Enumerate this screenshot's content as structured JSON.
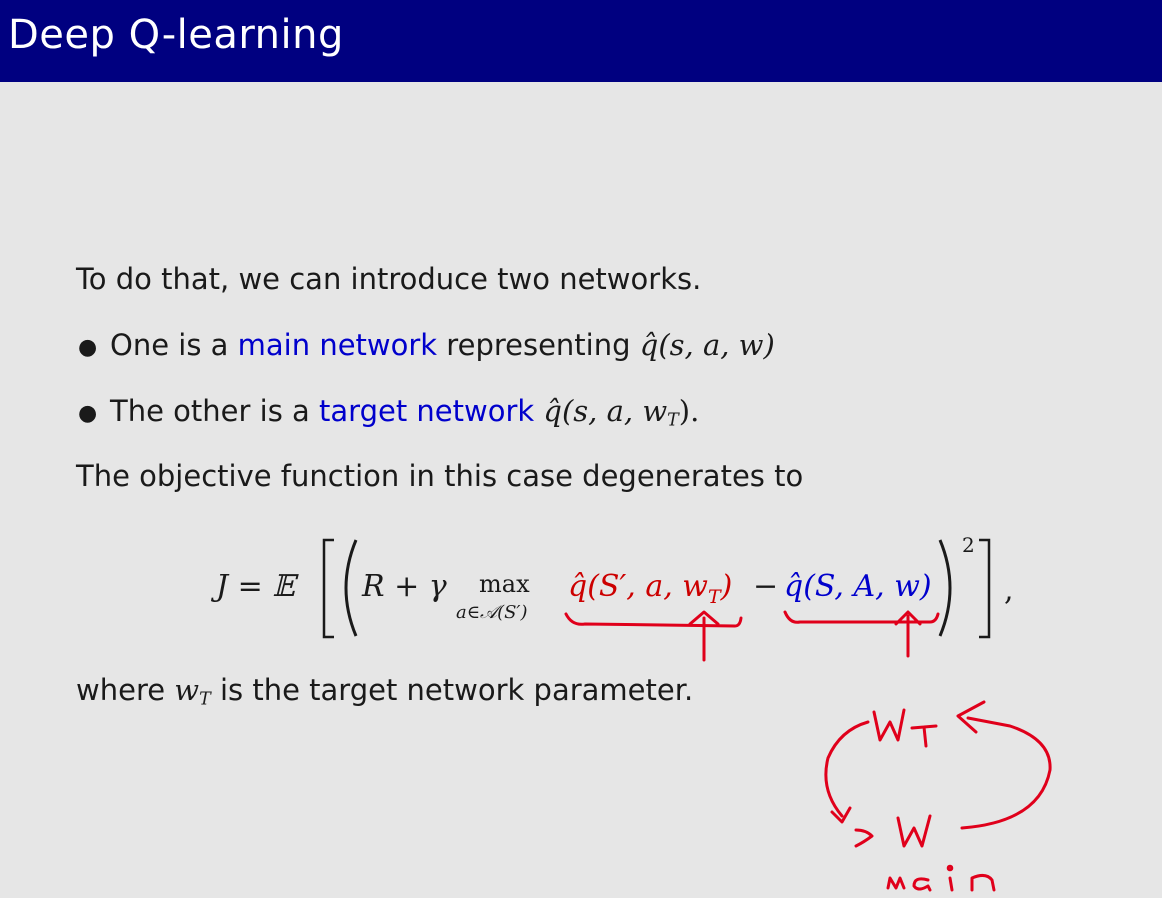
{
  "header": {
    "title": "Deep Q-learning"
  },
  "body": {
    "intro": "To do that, we can introduce two networks.",
    "bullet1": {
      "prefix": "One is a ",
      "highlight": "main network",
      "suffix": " representing ",
      "math": "q̂(s, a, w)"
    },
    "bullet2": {
      "prefix": "The other is a ",
      "highlight": "target network",
      "suffix": " ",
      "math": "q̂(s, a, w",
      "math_sub": "T",
      "math_tail": ")."
    },
    "objective_text": "The objective function in this case degenerates to",
    "equation": {
      "lhs": "J = 𝔼",
      "r_gamma": "R + γ",
      "max": "max",
      "max_sub": "a∈𝒜(S′)",
      "target_term": "q̂(S′, a, w",
      "target_sub": "T",
      "target_close": ")",
      "minus": "−",
      "main_term": "q̂(S, A, w)",
      "power": "2",
      "comma": ","
    },
    "where": {
      "prefix": "where ",
      "math": "w",
      "math_sub": "T",
      "suffix": " is the target network parameter."
    }
  },
  "annotations": {
    "label_wt": "WT",
    "label_w": "W",
    "label_main": "main"
  },
  "colors": {
    "header_bg": "#000080",
    "highlight_blue": "#0000cc",
    "annotation_red": "#e0001b",
    "background": "#e6e6e6"
  }
}
